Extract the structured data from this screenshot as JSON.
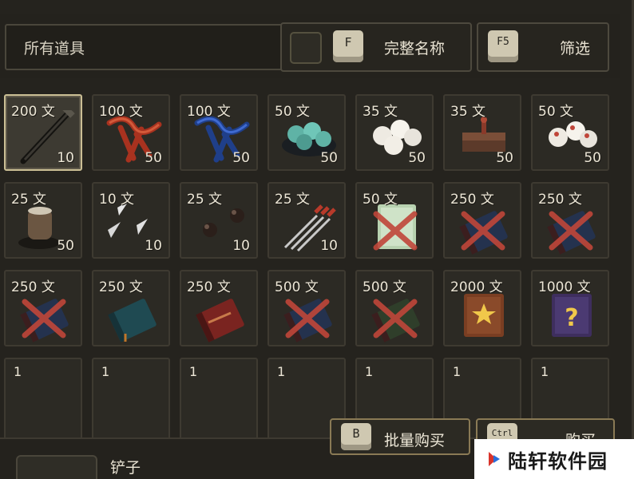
{
  "header": {
    "search_label": "所有道具",
    "fullname": {
      "key": "F",
      "label": "完整名称"
    },
    "filter": {
      "key": "F5",
      "label": "筛选"
    }
  },
  "items": [
    {
      "price": "200 文",
      "qty": "10",
      "icon": "shovel-icon",
      "selected": true
    },
    {
      "price": "100 文",
      "qty": "50",
      "icon": "red-rope-icon"
    },
    {
      "price": "100 文",
      "qty": "50",
      "icon": "blue-rope-icon"
    },
    {
      "price": "50 文",
      "qty": "50",
      "icon": "green-dumplings-icon"
    },
    {
      "price": "35 文",
      "qty": "50",
      "icon": "white-buns-icon"
    },
    {
      "price": "35 文",
      "qty": "50",
      "icon": "tofu-block-icon"
    },
    {
      "price": "50 文",
      "qty": "50",
      "icon": "red-dot-buns-icon"
    },
    {
      "price": "25 文",
      "qty": "50",
      "icon": "clay-pot-icon"
    },
    {
      "price": "10 文",
      "qty": "10",
      "icon": "throwing-knives-icon"
    },
    {
      "price": "25 文",
      "qty": "10",
      "icon": "iron-balls-icon"
    },
    {
      "price": "25 文",
      "qty": "10",
      "icon": "darts-icon"
    },
    {
      "price": "50 文",
      "qty": "",
      "icon": "locked-scroll-icon"
    },
    {
      "price": "250 文",
      "qty": "",
      "icon": "locked-manual-icon"
    },
    {
      "price": "250 文",
      "qty": "",
      "icon": "locked-manual-icon"
    },
    {
      "price": "250 文",
      "qty": "",
      "icon": "locked-manual-icon"
    },
    {
      "price": "250 文",
      "qty": "",
      "icon": "teal-book-icon"
    },
    {
      "price": "250 文",
      "qty": "",
      "icon": "red-book-icon"
    },
    {
      "price": "500 文",
      "qty": "",
      "icon": "locked-manual-icon"
    },
    {
      "price": "500 文",
      "qty": "",
      "icon": "locked-green-manual-icon"
    },
    {
      "price": "2000 文",
      "qty": "",
      "icon": "star-book-icon"
    },
    {
      "price": "1000 文",
      "qty": "",
      "icon": "mystery-book-icon"
    }
  ],
  "empty_slots": [
    "1",
    "1",
    "1",
    "1",
    "1",
    "1",
    "1"
  ],
  "actions": {
    "bulk": {
      "key": "B",
      "label": "批量购买"
    },
    "buy": {
      "key": "Ctrl",
      "label": "购买"
    }
  },
  "selected_name": "铲子",
  "watermark": "陆轩软件园",
  "colors": {
    "accent": "#cbbf95",
    "lock_x": "#c0463a",
    "panel": "#2c2a24"
  }
}
